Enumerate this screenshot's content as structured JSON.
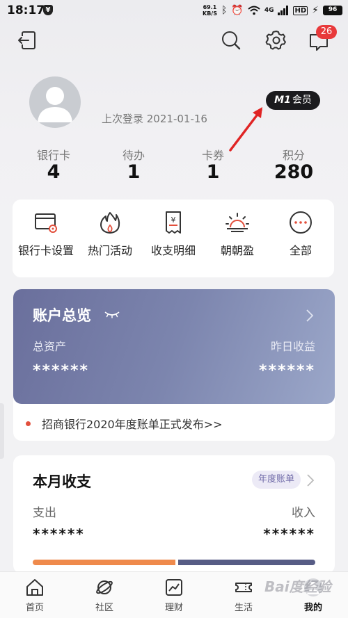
{
  "status_bar": {
    "time": "18:17",
    "net_speed_value": "69.1",
    "net_speed_unit": "KB/S",
    "signal": "4G",
    "battery": "96"
  },
  "header": {
    "notification_count": "26"
  },
  "profile": {
    "last_login": "上次登录 2021-01-16",
    "member_prefix": "M1",
    "member_label": "会员"
  },
  "stats": [
    {
      "label": "银行卡",
      "value": "4"
    },
    {
      "label": "待办",
      "value": "1"
    },
    {
      "label": "卡券",
      "value": "1"
    },
    {
      "label": "积分",
      "value": "280"
    }
  ],
  "quick_menu": [
    {
      "label": "银行卡设置",
      "icon": "card-settings-icon"
    },
    {
      "label": "热门活动",
      "icon": "flame-icon"
    },
    {
      "label": "收支明细",
      "icon": "receipt-icon"
    },
    {
      "label": "朝朝盈",
      "icon": "sunrise-icon"
    },
    {
      "label": "全部",
      "icon": "more-icon"
    }
  ],
  "account": {
    "title": "账户总览",
    "total_assets_label": "总资产",
    "total_assets_value": "******",
    "yesterday_income_label": "昨日收益",
    "yesterday_income_value": "******",
    "news": "招商银行2020年度账单正式发布>>"
  },
  "monthly": {
    "title": "本月收支",
    "annual_button": "年度账单",
    "expense_label": "支出",
    "expense_value": "******",
    "income_label": "收入",
    "income_value": "******"
  },
  "tabs": [
    {
      "label": "首页",
      "icon": "home-icon"
    },
    {
      "label": "社区",
      "icon": "planet-icon"
    },
    {
      "label": "理财",
      "icon": "chart-icon"
    },
    {
      "label": "生活",
      "icon": "ticket-icon"
    },
    {
      "label": "我的",
      "icon": "profile-icon"
    }
  ],
  "watermark": "Bai度经验",
  "colors": {
    "accent_red": "#e8393b",
    "account_card": "#7c85ae",
    "expense_bar": "#ef8a4c",
    "income_bar": "#575c85"
  }
}
